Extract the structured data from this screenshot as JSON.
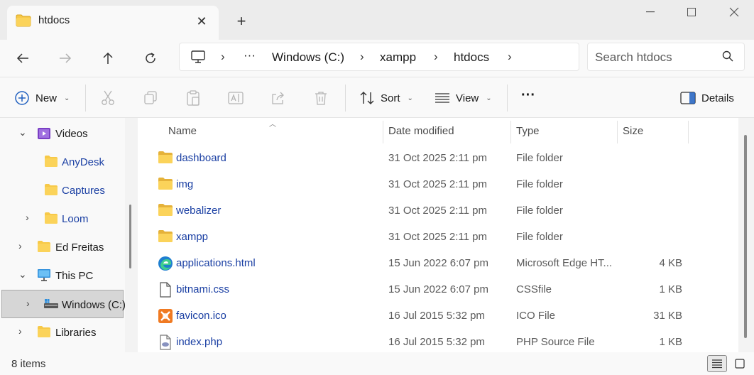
{
  "window": {
    "tab_title": "htdocs",
    "new_tab_icon": "plus-icon",
    "minimize_icon": "minimize-icon",
    "maximize_icon": "maximize-icon",
    "close_icon": "close-icon"
  },
  "nav": {
    "breadcrumb": [
      "Windows (C:)",
      "xampp",
      "htdocs"
    ],
    "more_crumbs": "···",
    "search_placeholder": "Search htdocs"
  },
  "toolbar": {
    "new_label": "New",
    "sort_label": "Sort",
    "view_label": "View",
    "more_label": "···",
    "details_label": "Details"
  },
  "sidebar": {
    "items": [
      {
        "label": "Videos",
        "icon": "videos-folder-icon",
        "expanded": true
      },
      {
        "label": "AnyDesk",
        "icon": "folder-icon"
      },
      {
        "label": "Captures",
        "icon": "folder-icon"
      },
      {
        "label": "Loom",
        "icon": "folder-icon"
      },
      {
        "label": "Ed Freitas",
        "icon": "folder-icon"
      },
      {
        "label": "This PC",
        "icon": "computer-icon",
        "expanded": true
      },
      {
        "label": "Windows (C:)",
        "icon": "drive-icon",
        "selected": true
      },
      {
        "label": "Libraries",
        "icon": "folder-icon"
      }
    ]
  },
  "list": {
    "columns": [
      "Name",
      "Date modified",
      "Type",
      "Size"
    ],
    "rows": [
      {
        "name": "dashboard",
        "date": "31 Oct 2025 2:11 pm",
        "type": "File folder",
        "size": "",
        "icon": "folder-icon"
      },
      {
        "name": "img",
        "date": "31 Oct 2025 2:11 pm",
        "type": "File folder",
        "size": "",
        "icon": "folder-icon"
      },
      {
        "name": "webalizer",
        "date": "31 Oct 2025 2:11 pm",
        "type": "File folder",
        "size": "",
        "icon": "folder-icon"
      },
      {
        "name": "xampp",
        "date": "31 Oct 2025 2:11 pm",
        "type": "File folder",
        "size": "",
        "icon": "folder-icon"
      },
      {
        "name": "applications.html",
        "date": "15 Jun 2022 6:07 pm",
        "type": "Microsoft Edge HT...",
        "size": "4 KB",
        "icon": "edge-icon"
      },
      {
        "name": "bitnami.css",
        "date": "15 Jun 2022 6:07 pm",
        "type": "CSSfile",
        "size": "1 KB",
        "icon": "document-icon"
      },
      {
        "name": "favicon.ico",
        "date": "16 Jul 2015 5:32 pm",
        "type": "ICO File",
        "size": "31 KB",
        "icon": "xampp-icon"
      },
      {
        "name": "index.php",
        "date": "16 Jul 2015 5:32 pm",
        "type": "PHP Source File",
        "size": "1 KB",
        "icon": "php-file-icon"
      }
    ]
  },
  "status": {
    "item_count": "8 items"
  },
  "colors": {
    "folder_yellow": "#f7c948",
    "link_blue": "#1a3fa3",
    "accent": "#0067c0"
  }
}
